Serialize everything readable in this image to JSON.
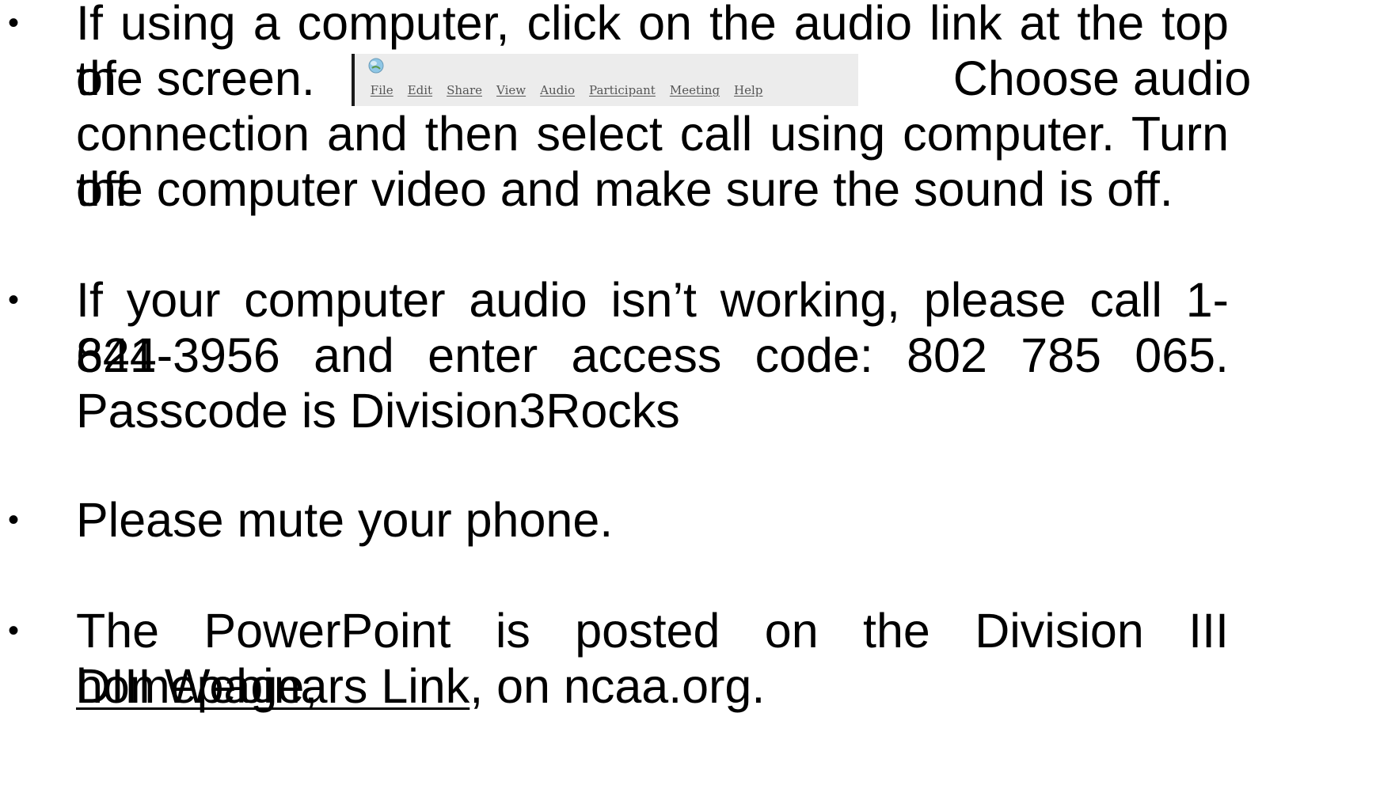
{
  "bullets": [
    {
      "marker": "•",
      "lines": [
        "If using a computer, click on the audio link at the top of",
        "the screen.",
        "Choose audio",
        "connection and then select call using computer. Turn off",
        "the computer video and make sure the sound is off."
      ],
      "menu_screenshot": {
        "icon": "globe-icon",
        "items": [
          "File",
          "Edit",
          "Share",
          "View",
          "Audio",
          "Participant",
          "Meeting",
          "Help"
        ]
      }
    },
    {
      "marker": "•",
      "lines": [
        "If your computer audio isn’t working, please call 1-844-",
        "621-3956 and enter access code: 802 785 065.",
        "Passcode is Division3Rocks"
      ]
    },
    {
      "marker": "•",
      "lines": [
        "Please mute your phone."
      ]
    },
    {
      "marker": "•",
      "lines": [
        "The PowerPoint is posted on the Division III homepage,",
        "DIII Webinars Link",
        ", on ncaa.org."
      ]
    }
  ]
}
